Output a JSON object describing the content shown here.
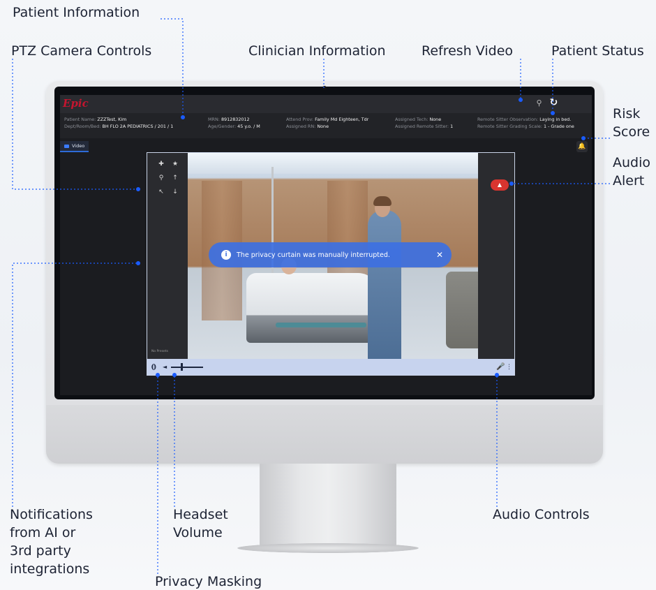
{
  "callouts": {
    "patient_information": "Patient Information",
    "ptz_camera_controls": "PTZ Camera Controls",
    "clinician_information": "Clinician Information",
    "refresh_video": "Refresh Video",
    "patient_status": "Patient Status",
    "risk_score_line1": "Risk",
    "risk_score_line2": "Score",
    "audio_alert_line1": "Audio",
    "audio_alert_line2": "Alert",
    "notifications_line1": "Notifications",
    "notifications_line2": "from AI or",
    "notifications_line3": "3rd party",
    "notifications_line4": "integrations",
    "headset_volume_line1": "Headset",
    "headset_volume_line2": "Volume",
    "audio_controls": "Audio Controls",
    "privacy_masking": "Privacy Masking"
  },
  "app": {
    "logo": "Epic"
  },
  "patient": {
    "name_label": "Patient Name:",
    "name_value": "ZZZTest, Kim",
    "dept_label": "Dept/Room/Bed:",
    "dept_value": "BH FLO 2A PEDIATRICS / 201 / 1",
    "mrn_label": "MRN:",
    "mrn_value": "8912832012",
    "age_label": "Age/Gender:",
    "age_value": "45 y.o. / M"
  },
  "clinician": {
    "attend_label": "Attend Prov:",
    "attend_value": "Family Md Eighteen, Tdr",
    "rn_label": "Assigned RN:",
    "rn_value": "None",
    "tech_label": "Assigned Tech:",
    "tech_value": "None",
    "sitter_label": "Assigned Remote Sitter:",
    "sitter_value": "1"
  },
  "status": {
    "observation_label": "Remote Sitter Observation:",
    "observation_value": "Laying in bed.",
    "grading_label": "Remote Sitter Grading Scale:",
    "grading_value": "1 - Grade one"
  },
  "video": {
    "tab_label": "Video",
    "no_presets": "No Presets",
    "toast_message": "The privacy curtain was manually interrupted."
  },
  "icons": {
    "search": "search-icon",
    "refresh": "refresh-icon",
    "bell": "bell-icon",
    "info": "info-icon",
    "close": "close-icon",
    "alert": "warning-icon",
    "microphone": "microphone-icon",
    "speaker": "speaker-icon"
  },
  "colors": {
    "accent": "#1a5cff",
    "alert_red": "#d9352f",
    "toast_blue": "#3d70e2",
    "epic_red": "#c4152f"
  }
}
